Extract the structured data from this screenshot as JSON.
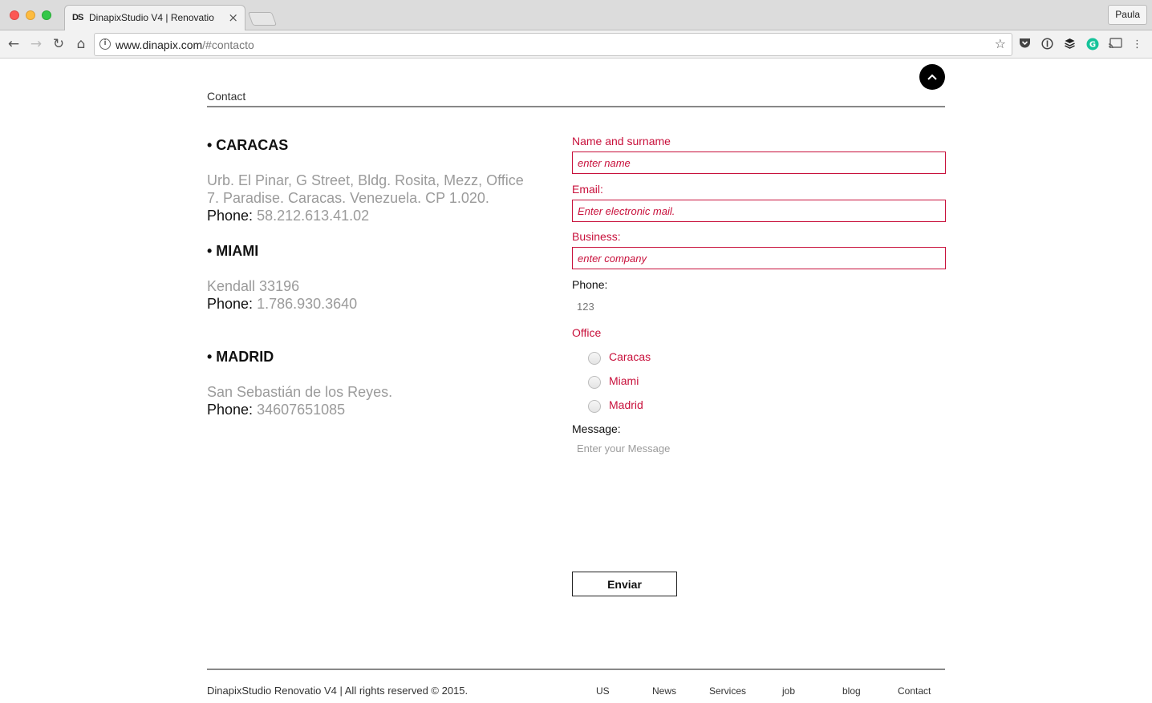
{
  "browser": {
    "tab_favicon": "DS",
    "tab_title": "DinapixStudio V4 | Renovatio",
    "tab_close": "×",
    "profile_name": "Paula",
    "url_host": "www.dinapix.com",
    "url_path": "/#contacto",
    "icons": [
      "back-icon",
      "forward-icon",
      "reload-icon",
      "home-icon",
      "info-icon",
      "star-icon",
      "pocket-icon",
      "onepassword-icon",
      "buffer-icon",
      "grammarly-icon",
      "cast-icon",
      "menu-icon"
    ]
  },
  "page": {
    "section_title": "Contact",
    "offices": [
      {
        "heading": "• CARACAS",
        "address": "Urb. El Pinar, G Street, Bldg. Rosita, Mezz, Office 7. Paradise. Caracas. Venezuela. CP 1.020.",
        "phone_label": "Phone: ",
        "phone": "58.212.613.41.02"
      },
      {
        "heading": "• MIAMI",
        "address": "Kendall 33196",
        "phone_label": "Phone: ",
        "phone": "1.786.930.3640"
      },
      {
        "heading": "• MADRID",
        "address": "San Sebastián de los Reyes.",
        "phone_label": "Phone: ",
        "phone": "34607651085"
      }
    ],
    "form": {
      "name_label": "Name and surname",
      "name_placeholder": "enter name",
      "email_label": "Email:",
      "email_placeholder": "Enter electronic mail.",
      "business_label": "Business:",
      "business_placeholder": "enter company",
      "phone_label": "Phone:",
      "phone_placeholder": "123",
      "office_label": "Office",
      "office_options": [
        "Caracas",
        "Miami",
        "Madrid"
      ],
      "message_label": "Message:",
      "message_placeholder": "Enter your Message",
      "submit_label": "Enviar"
    },
    "footer": {
      "copyright": "DinapixStudio Renovatio V4 | All rights reserved © 2015.",
      "nav": [
        "US",
        "News",
        "Services",
        "job",
        "blog",
        "Contact"
      ]
    },
    "accent_color": "#c8103b"
  }
}
